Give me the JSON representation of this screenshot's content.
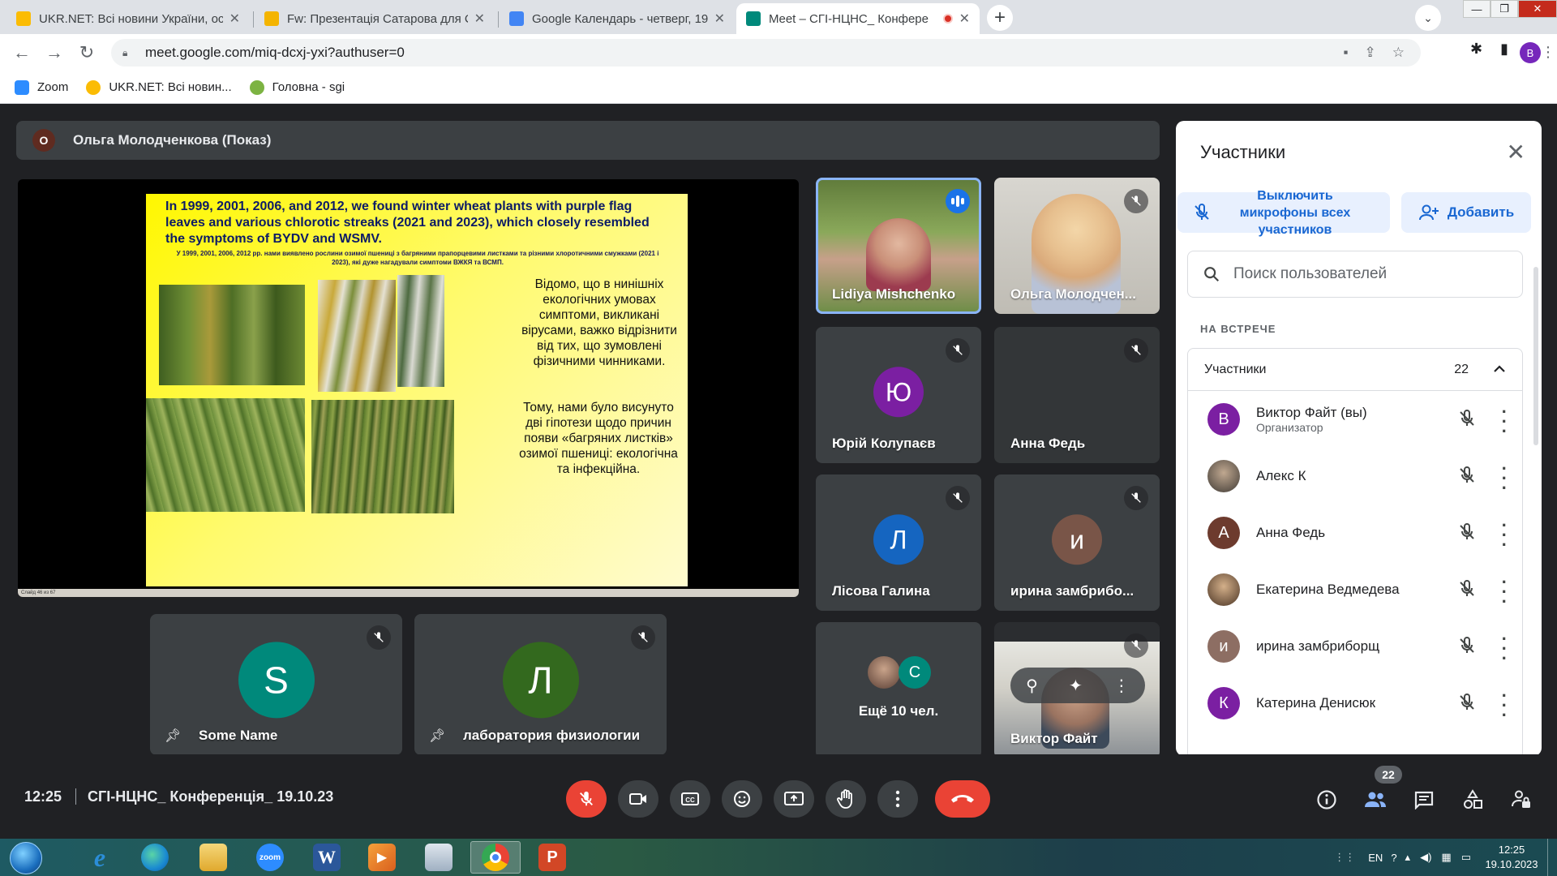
{
  "tabs": [
    {
      "title": "UKR.NET: Всі новини України, ос",
      "color": "#fbbc04"
    },
    {
      "title": "Fw: Презентація Сатарова для С",
      "color": "#f4b400"
    },
    {
      "title": "Google Календарь - четверг, 19",
      "color": "#4285f4"
    },
    {
      "title": "Meet – СГІ-НЦНС_ Конфере",
      "color": "#00897b"
    }
  ],
  "browser": {
    "url": "meet.google.com/miq-dcxj-yxi?authuser=0",
    "profile_initial": "B"
  },
  "bookmarks": [
    {
      "label": "Zoom",
      "color": "#2d8cff"
    },
    {
      "label": "UKR.NET: Всі новин...",
      "color": "#fbbc04"
    },
    {
      "label": "Головна - sgi",
      "color": "#7cb342"
    }
  ],
  "presenter": {
    "initial": "О",
    "label": "Ольга Молодченкова (Показ)"
  },
  "slide": {
    "heading_en": "In 1999, 2001, 2006, and 2012, we found winter wheat plants with purple flag leaves and various chlorotic streaks (2021 and 2023), which closely resembled the symptoms  of BYDV and WSMV.",
    "heading_ua": "У 1999, 2001, 2006, 2012 рр. нами виявлено рослини озимої пшениці з багряними прапорцевими листками та різними хлоротичними смужками (2021 і 2023), які дуже нагадували симптоми ВЖКЯ та ВСМП.",
    "text1": "Відомо, що в нинішніх екологічних умовах симптоми, викликані вірусами, важко відрізнити від тих, що зумовлені фізичними чинниками.",
    "text2": "Тому, нами було висунуто дві гіпотези щодо причин появи «багряних листків» озимої пшениці: екологічна  та інфекційна.",
    "status": "Слайд 46 из 67"
  },
  "tiles": [
    {
      "name": "Lidiya Mishchenko"
    },
    {
      "name": "Ольга Молодчен..."
    },
    {
      "name": "Юрій Колупаєв",
      "initial": "Ю",
      "color": "#7b1fa2"
    },
    {
      "name": "Анна Федь"
    },
    {
      "name": "Лісова Галина",
      "initial": "Л",
      "color": "#1565c0"
    },
    {
      "name": "ирина замбрибо...",
      "initial": "и",
      "color": "#795548"
    },
    {
      "name": "Ещё 10 чел.",
      "initial": "С",
      "color": "#00897b"
    },
    {
      "name": "Виктор Файт"
    }
  ],
  "bottom_tiles": [
    {
      "name": "Some Name",
      "initial": "S",
      "color": "#00897b"
    },
    {
      "name": "лаборатория физиологии",
      "initial": "Л",
      "color": "#33691e"
    }
  ],
  "panel": {
    "title": "Участники",
    "mute_all": "Выключить микрофоны всех участников",
    "add": "Добавить",
    "search_placeholder": "Поиск пользователей",
    "section": "НА ВСТРЕЧЕ",
    "group_label": "Участники",
    "group_count": "22",
    "participants": [
      {
        "name": "Виктор Файт (вы)",
        "role": "Организатор",
        "initial": "В",
        "color": "#7b1fa2"
      },
      {
        "name": "Алекс К",
        "initial": "",
        "color": "#6d5a4a"
      },
      {
        "name": "Анна Федь",
        "initial": "А",
        "color": "#6d3b2e"
      },
      {
        "name": "Екатерина Ведмедева",
        "initial": "",
        "color": "#8a6b4a"
      },
      {
        "name": "ирина замбриборщ",
        "initial": "и",
        "color": "#8d6e63"
      },
      {
        "name": "Катерина Денисюк",
        "initial": "К",
        "color": "#7b1fa2"
      }
    ]
  },
  "controls": {
    "time": "12:25",
    "meeting": "СГІ-НЦНС_ Конференція_ 19.10.23",
    "people_badge": "22"
  },
  "taskbar": {
    "zoom_label": "zoom",
    "lang": "EN",
    "time": "12:25",
    "date": "19.10.2023"
  }
}
